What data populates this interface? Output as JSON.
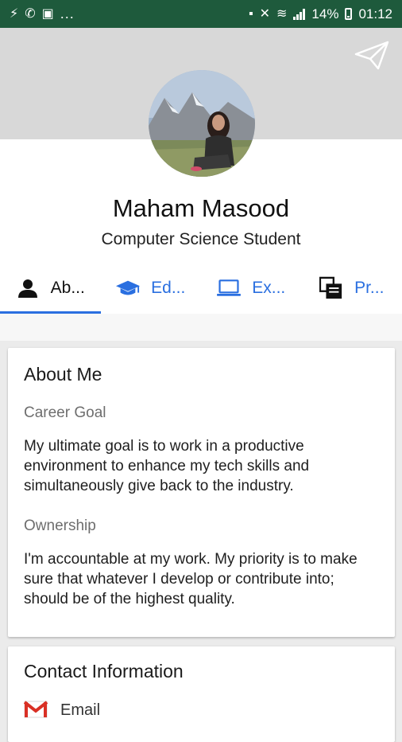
{
  "status_bar": {
    "left_ellipsis": "...",
    "battery_text": "14%",
    "time": "01:12"
  },
  "profile": {
    "name": "Maham Masood",
    "title": "Computer Science Student"
  },
  "tabs": [
    {
      "label": "Ab...",
      "icon": "person-icon",
      "active": true
    },
    {
      "label": "Ed...",
      "icon": "graduation-cap-icon",
      "active": false
    },
    {
      "label": "Ex...",
      "icon": "laptop-icon",
      "active": false
    },
    {
      "label": "Pr...",
      "icon": "projects-icon",
      "active": false
    }
  ],
  "about": {
    "heading": "About Me",
    "career_label": "Career Goal",
    "career_text": "My ultimate goal is to work in a productive environment to enhance my tech skills and simultaneously give back to the industry.",
    "ownership_label": "Ownership",
    "ownership_text": "I'm accountable at my work. My priority is to make sure that whatever I develop or contribute into; should be of the highest quality."
  },
  "contact": {
    "heading": "Contact Information",
    "email_label": "Email"
  },
  "colors": {
    "status_bar": "#1e5a3c",
    "accent": "#2a6fe0",
    "cover": "#d8d8d8"
  }
}
